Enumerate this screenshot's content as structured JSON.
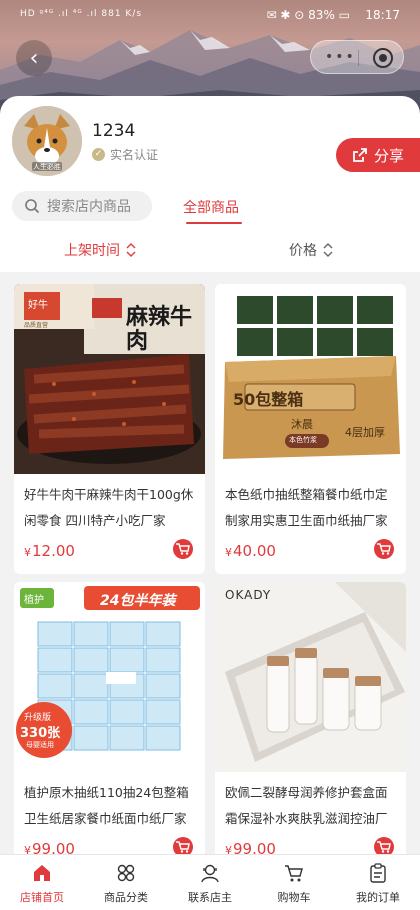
{
  "status_bar": {
    "left_text": "HD ᵍ⁴ᴳ .ıl ⁴ᴳ .ıl 881 K/s",
    "right_text": "✉ ✱ ⊙ 83% ▭",
    "time": "18:17"
  },
  "shop": {
    "name": "1234",
    "verification": "实名认证",
    "share_label": "分享"
  },
  "search": {
    "placeholder": "搜索店内商品"
  },
  "tabs": {
    "all_products": "全部商品"
  },
  "sort": {
    "time_label": "上架时间",
    "price_label": "价格"
  },
  "products": [
    {
      "title": "好牛牛肉干麻辣牛肉干100g休闲零食 四川特产小吃厂家",
      "currency": "¥",
      "price": "12.00",
      "image_text": "麻辣牛肉"
    },
    {
      "title": "本色纸巾抽纸整箱餐巾纸巾定制家用实惠卫生面巾纸抽厂家",
      "currency": "¥",
      "price": "40.00",
      "image_text": "50包整箱"
    },
    {
      "title": "植护原木抽纸110抽24包整箱卫生纸居家餐巾纸面巾纸厂家",
      "currency": "¥",
      "price": "99.00",
      "image_text": "24包半年装"
    },
    {
      "title": "欧佩二裂酵母润养修护套盒面霜保湿补水爽肤乳滋润控油厂家",
      "currency": "¥",
      "price": "99.00",
      "image_text": "OKADY"
    }
  ],
  "image_labels": {
    "beef_brand": "好牛",
    "beef_sub": "品质直营",
    "box_brand": "沐晨",
    "box_tag": "本色竹浆",
    "box_layers": "4层加厚",
    "tissue_brand": "植护",
    "tissue_promo": "升级版",
    "tissue_count": "330张",
    "tissue_note": "母婴适用",
    "avatar_caption": "人生必胜"
  },
  "bottom_nav": [
    {
      "label": "店铺首页",
      "icon": "home-icon"
    },
    {
      "label": "商品分类",
      "icon": "category-icon"
    },
    {
      "label": "联系店主",
      "icon": "contact-icon"
    },
    {
      "label": "购物车",
      "icon": "cart-icon"
    },
    {
      "label": "我的订单",
      "icon": "orders-icon"
    }
  ],
  "colors": {
    "accent": "#e03a3c",
    "text": "#333333",
    "muted": "#888888",
    "background": "#f2f2f2"
  }
}
